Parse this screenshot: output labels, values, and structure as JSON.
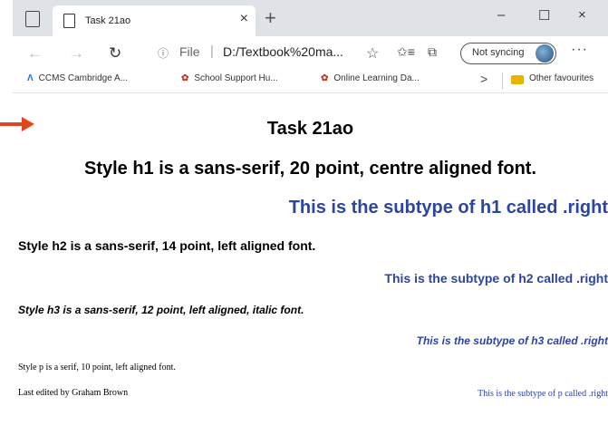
{
  "tab": {
    "title": "Task 21ao",
    "close": "×",
    "new_tab": "+"
  },
  "window_controls": {
    "minimize": "–",
    "maximize": "☐",
    "close": "×"
  },
  "address": {
    "back": "←",
    "forward": "→",
    "refresh": "↻",
    "info_icon": "ⓘ",
    "scheme": "File",
    "separator": "|",
    "url": "D:/Textbook%20ma...",
    "star": "☆",
    "favorites": "✩≡",
    "collections": "⧉",
    "sync_label": "Not syncing",
    "more": "···"
  },
  "favourites": {
    "items": [
      {
        "label": "CCMS Cambridge A...",
        "icon": "Λ"
      },
      {
        "label": "School Support Hu...",
        "icon": "✿"
      },
      {
        "label": "Online Learning Da...",
        "icon": "✿"
      }
    ],
    "chevron": ">",
    "other": "Other favourites"
  },
  "page": {
    "title": "Task 21ao",
    "h1": "Style h1 is a sans-serif, 20 point, centre aligned font.",
    "h1_right": "This is the subtype of h1 called .right",
    "h2": "Style h2 is a sans-serif, 14 point, left aligned font.",
    "h2_right": "This is the subtype of h2 called .right",
    "h3": "Style h3 is a sans-serif, 12 point, left aligned, italic font.",
    "h3_right": "This is the subtype of h3 called .right",
    "p": "Style p is a serif, 10 point, left aligned font.",
    "p_right": "This is the subtype of p called .right",
    "footer": "Last edited by Graham Brown"
  },
  "colors": {
    "accent_blue": "#2d45a0",
    "annotation_arrow": "#e2451e"
  }
}
